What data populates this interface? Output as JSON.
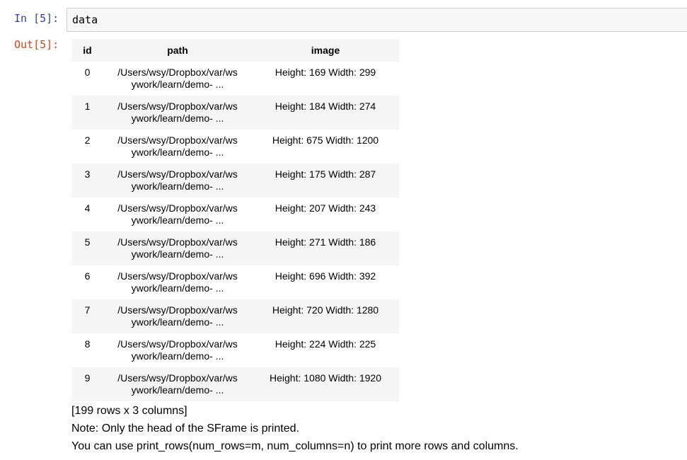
{
  "input": {
    "prompt": "In [5]:",
    "code": "data"
  },
  "output": {
    "prompt": "Out[5]:",
    "table": {
      "columns": [
        "id",
        "path",
        "image"
      ],
      "rows": [
        {
          "id": "0",
          "path_line1": "/Users/wsy/Dropbox/var/ws",
          "path_line2": "ywork/learn/demo- ...",
          "image": "Height: 169 Width: 299"
        },
        {
          "id": "1",
          "path_line1": "/Users/wsy/Dropbox/var/ws",
          "path_line2": "ywork/learn/demo- ...",
          "image": "Height: 184 Width: 274"
        },
        {
          "id": "2",
          "path_line1": "/Users/wsy/Dropbox/var/ws",
          "path_line2": "ywork/learn/demo- ...",
          "image": "Height: 675 Width: 1200"
        },
        {
          "id": "3",
          "path_line1": "/Users/wsy/Dropbox/var/ws",
          "path_line2": "ywork/learn/demo- ...",
          "image": "Height: 175 Width: 287"
        },
        {
          "id": "4",
          "path_line1": "/Users/wsy/Dropbox/var/ws",
          "path_line2": "ywork/learn/demo- ...",
          "image": "Height: 207 Width: 243"
        },
        {
          "id": "5",
          "path_line1": "/Users/wsy/Dropbox/var/ws",
          "path_line2": "ywork/learn/demo- ...",
          "image": "Height: 271 Width: 186"
        },
        {
          "id": "6",
          "path_line1": "/Users/wsy/Dropbox/var/ws",
          "path_line2": "ywork/learn/demo- ...",
          "image": "Height: 696 Width: 392"
        },
        {
          "id": "7",
          "path_line1": "/Users/wsy/Dropbox/var/ws",
          "path_line2": "ywork/learn/demo- ...",
          "image": "Height: 720 Width: 1280"
        },
        {
          "id": "8",
          "path_line1": "/Users/wsy/Dropbox/var/ws",
          "path_line2": "ywork/learn/demo- ...",
          "image": "Height: 224 Width: 225"
        },
        {
          "id": "9",
          "path_line1": "/Users/wsy/Dropbox/var/ws",
          "path_line2": "ywork/learn/demo- ...",
          "image": "Height: 1080 Width: 1920"
        }
      ]
    },
    "summary": "[199 rows x 3 columns]",
    "note": "Note: Only the head of the SFrame is printed.",
    "hint": "You can use print_rows(num_rows=m, num_columns=n) to print more rows and columns."
  },
  "colors": {
    "in_prompt": "#303f9f",
    "out_prompt": "#d84315",
    "input_bg": "#f7f7f7",
    "stripe_bg": "#f5f5f5"
  }
}
